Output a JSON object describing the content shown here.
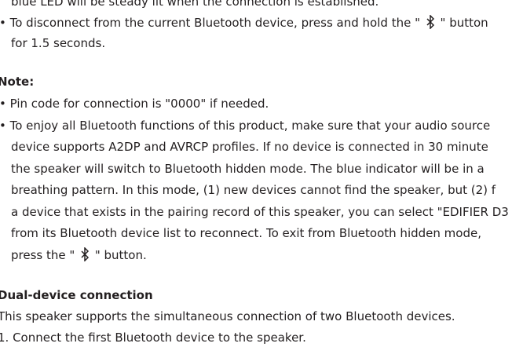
{
  "doc": {
    "intro_lines": [
      "blue LED will be steady lit when the connection is established.",
      "• To disconnect from the current Bluetooth device, press and hold the \"",
      "\" button",
      "for 1.5 seconds."
    ],
    "note": {
      "heading": "Note:",
      "lines": [
        "• Pin code for connection is \"0000\" if needed.",
        "• To enjoy all Bluetooth functions of this product, make sure that your audio source",
        "device supports A2DP and AVRCP profiles. If no device is connected in 30 minute",
        "the speaker will switch to Bluetooth hidden mode. The blue indicator will be in a",
        "breathing pattern. In this mode, (1) new devices cannot find the speaker, but (2) f",
        "a device that exists in the pairing record of this speaker, you can select \"EDIFIER D3",
        "from its Bluetooth device list to reconnect. To exit from Bluetooth hidden mode,",
        "press the \"",
        "\" button."
      ]
    },
    "dual": {
      "heading": "Dual-device connection",
      "lines": [
        "This speaker supports the simultaneous connection of two Bluetooth devices.",
        "1. Connect the first Bluetooth device to the speaker."
      ]
    }
  }
}
